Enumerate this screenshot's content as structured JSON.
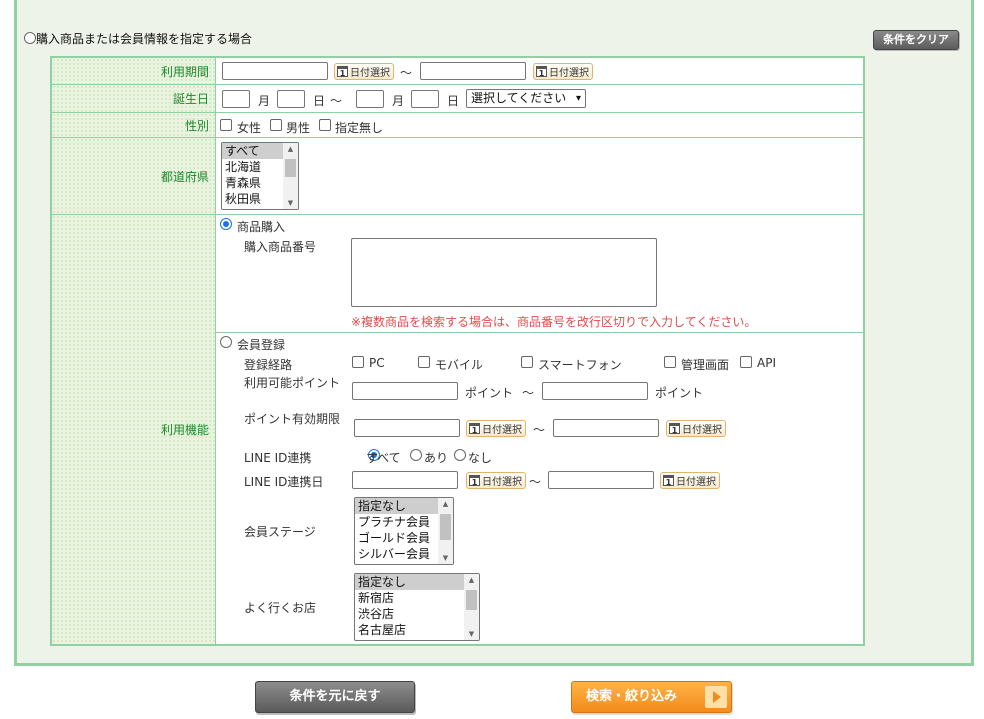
{
  "top": {
    "mode_label": "購入商品または会員情報を指定する場合",
    "clear_button": "条件をクリア"
  },
  "rows": {
    "usage_period": "利用期間",
    "birthday": "誕生日",
    "gender": "性別",
    "prefecture": "都道府県",
    "usage_function": "利用機能"
  },
  "date_select_label": "日付選択",
  "cal_digit": "1",
  "tilde": "〜",
  "birthday": {
    "month": "月",
    "day": "日",
    "select_value": "選択してください"
  },
  "gender": {
    "options": [
      "女性",
      "男性",
      "指定無し"
    ]
  },
  "prefecture_list": [
    "すべて",
    "北海道",
    "青森県",
    "秋田県"
  ],
  "purchase": {
    "radio_label": "商品購入",
    "product_number_label": "購入商品番号",
    "note": "※複数商品を検索する場合は、商品番号を改行区切りで入力してください。"
  },
  "member": {
    "radio_label": "会員登録",
    "route_label": "登録経路",
    "routes": [
      "PC",
      "モバイル",
      "スマートフォン",
      "管理画面",
      "API"
    ],
    "points_label": "利用可能ポイント",
    "points_unit": "ポイント",
    "points_expiry_label": "ポイント有効期限",
    "line_link_label": "LINE ID連携",
    "line_options": [
      "すべて",
      "あり",
      "なし"
    ],
    "line_date_label": "LINE ID連携日",
    "stage_label": "会員ステージ",
    "stage_list": [
      "指定なし",
      "プラチナ会員",
      "ゴールド会員",
      "シルバー会員"
    ],
    "store_label": "よく行くお店",
    "store_list": [
      "指定なし",
      "新宿店",
      "渋谷店",
      "名古屋店"
    ]
  },
  "buttons": {
    "reset": "条件を元に戻す",
    "search": "検索・絞り込み"
  },
  "colors": {
    "label_text": "#1c8a2e",
    "border_green": "#8fd1a2",
    "note_red": "#e04c4c",
    "search_orange": "#f38b1c"
  }
}
